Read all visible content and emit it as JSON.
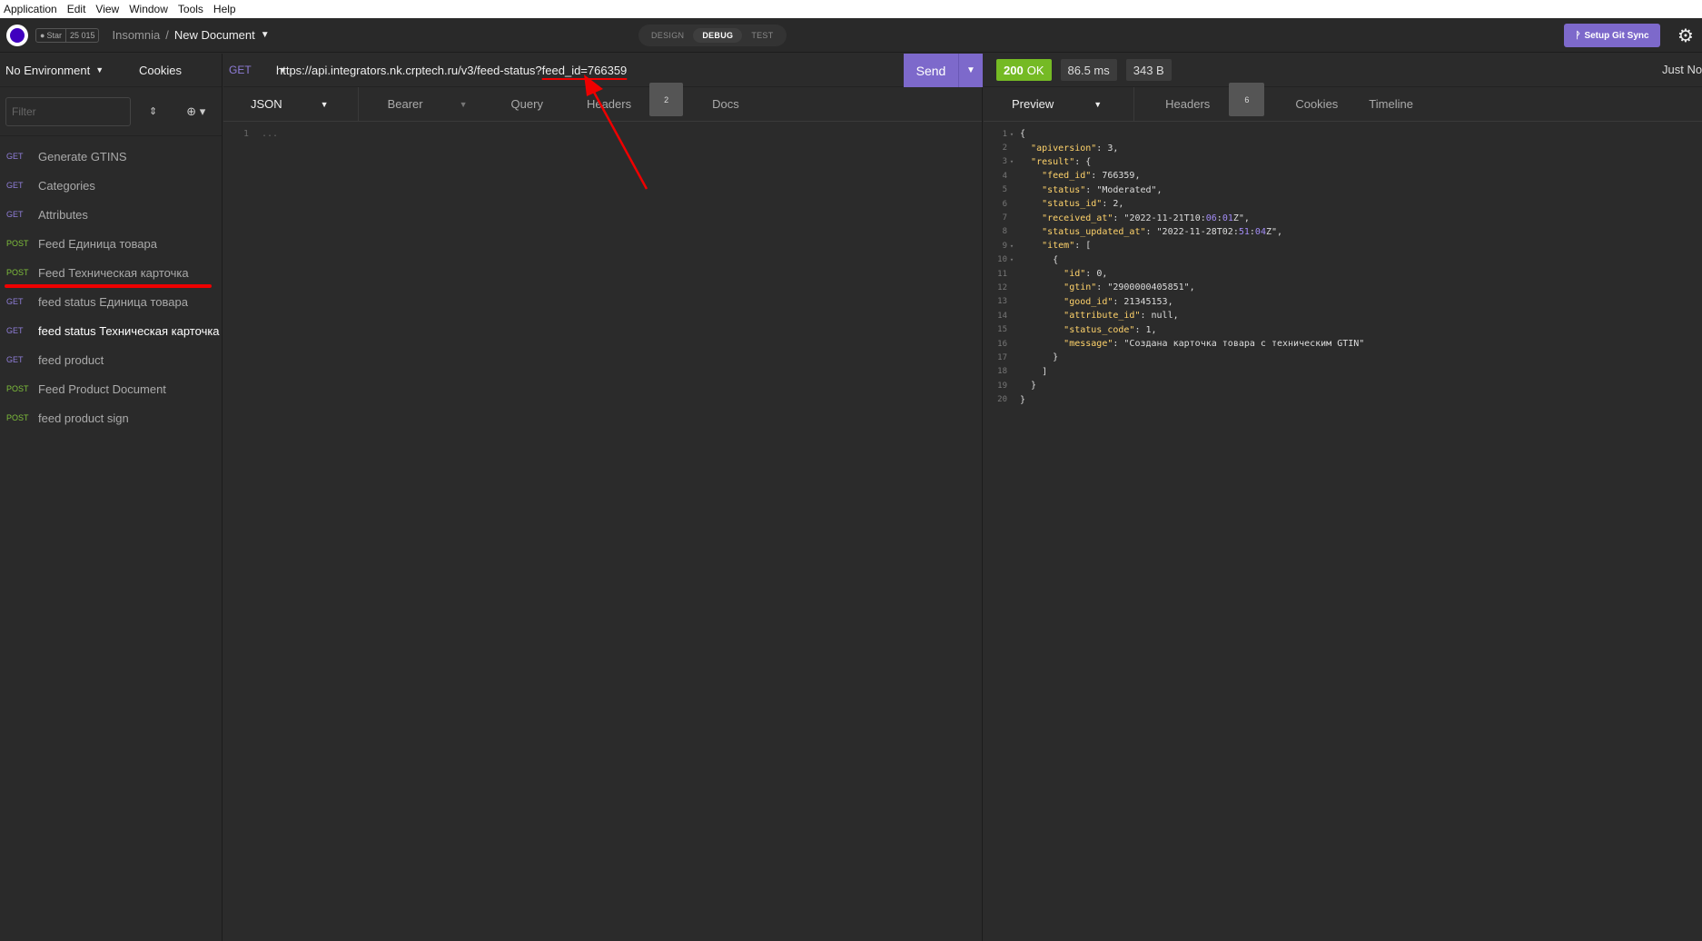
{
  "menubar": [
    "Application",
    "Edit",
    "View",
    "Window",
    "Tools",
    "Help"
  ],
  "appbar": {
    "github_star": "Star",
    "github_count": "25 015",
    "app_name": "Insomnia",
    "separator": "/",
    "document": "New Document",
    "modes": [
      "DESIGN",
      "DEBUG",
      "TEST"
    ],
    "active_mode": "DEBUG",
    "git_sync": "Setup Git Sync"
  },
  "sidebar": {
    "environment": "No Environment",
    "cookies": "Cookies",
    "filter_placeholder": "Filter",
    "requests": [
      {
        "method": "GET",
        "name": "Generate GTINS"
      },
      {
        "method": "GET",
        "name": "Categories"
      },
      {
        "method": "GET",
        "name": "Attributes"
      },
      {
        "method": "POST",
        "name": "Feed Единица товара"
      },
      {
        "method": "POST",
        "name": "Feed Техническая карточка"
      },
      {
        "method": "GET",
        "name": "feed status Единица товара"
      },
      {
        "method": "GET",
        "name": "feed status Техническая карточка"
      },
      {
        "method": "GET",
        "name": "feed product"
      },
      {
        "method": "POST",
        "name": "Feed Product Document"
      },
      {
        "method": "POST",
        "name": "feed product sign"
      }
    ],
    "active_index": 6
  },
  "request": {
    "method": "GET",
    "url_base": "https://api.integrators.nk.crptech.ru/v3/feed-status?",
    "url_query": "feed_id=766359",
    "send": "Send",
    "tabs": {
      "body": "JSON",
      "auth": "Bearer",
      "query": "Query",
      "headers": "Headers",
      "headers_count": "2",
      "docs": "Docs"
    },
    "editor_line_no": "1",
    "editor_placeholder": "..."
  },
  "response": {
    "status_code": "200",
    "status_text": "OK",
    "time": "86.5 ms",
    "size": "343 B",
    "timestamp": "Just Now",
    "tabs": {
      "preview": "Preview",
      "headers": "Headers",
      "headers_count": "6",
      "cookies": "Cookies",
      "timeline": "Timeline"
    },
    "body_lines": [
      "{",
      "  \"apiversion\": 3,",
      "  \"result\": {",
      "    \"feed_id\": 766359,",
      "    \"status\": \"Moderated\",",
      "    \"status_id\": 2,",
      "    \"received_at\": \"2022-11-21T10:06:01Z\",",
      "    \"status_updated_at\": \"2022-11-28T02:51:04Z\",",
      "    \"item\": [",
      "      {",
      "        \"id\": 0,",
      "        \"gtin\": \"2900000405851\",",
      "        \"good_id\": 21345153,",
      "        \"attribute_id\": null,",
      "        \"status_code\": 1,",
      "        \"message\": \"Создана карточка товара с техническим GTIN\"",
      "      }",
      "    ]",
      "  }",
      "}"
    ]
  },
  "colors": {
    "accent": "#7d69cb",
    "ok_green": "#75ba24",
    "get_method": "#8f7dd8",
    "post_method": "#7fbf3b",
    "annotation_red": "#ee0000"
  }
}
